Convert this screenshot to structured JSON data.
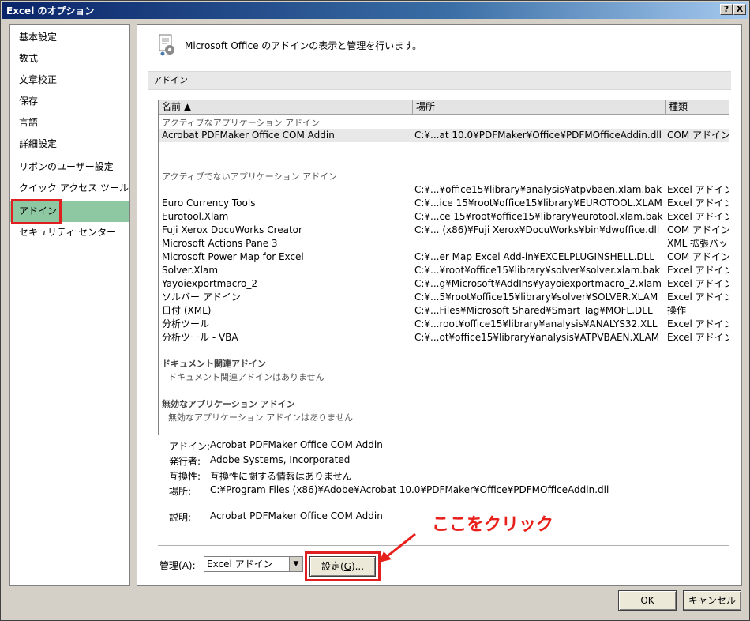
{
  "window": {
    "title": "Excel のオプション",
    "help_btn": "?",
    "close_btn": "X"
  },
  "nav": {
    "items": [
      {
        "label": "基本設定"
      },
      {
        "label": "数式"
      },
      {
        "label": "文章校正"
      },
      {
        "label": "保存"
      },
      {
        "label": "言語"
      },
      {
        "label": "詳細設定"
      },
      {
        "label": "リボンのユーザー設定"
      },
      {
        "label": "クイック アクセス ツール バー"
      },
      {
        "label": "アドイン",
        "active": true
      },
      {
        "label": "セキュリティ センター"
      }
    ]
  },
  "header": {
    "text": "Microsoft Office のアドインの表示と管理を行います。",
    "icon": "addin-gear-icon"
  },
  "section": {
    "title": "アドイン"
  },
  "table": {
    "columns": [
      "名前 ▲",
      "場所",
      "種類"
    ],
    "groups": {
      "active": "アクティブなアプリケーション アドイン",
      "inactive": "アクティブでないアプリケーション アドイン",
      "document": "ドキュメント関連アドイン",
      "document_empty": "ドキュメント関連アドインはありません",
      "disabled": "無効なアプリケーション アドイン",
      "disabled_empty": "無効なアプリケーション アドインはありません"
    },
    "active_rows": [
      {
        "name": "Acrobat PDFMaker Office COM Addin",
        "location": "C:¥...at 10.0¥PDFMaker¥Office¥PDFMOfficeAddin.dll",
        "type": "COM アドイン"
      }
    ],
    "inactive_rows": [
      {
        "name": "-",
        "location": "C:¥...¥office15¥library¥analysis¥atpvbaen.xlam.bak",
        "type": "Excel アドイン"
      },
      {
        "name": "Euro Currency Tools",
        "location": "C:¥...ice 15¥root¥office15¥library¥EUROTOOL.XLAM",
        "type": "Excel アドイン"
      },
      {
        "name": "Eurotool.Xlam",
        "location": "C:¥...ce 15¥root¥office15¥library¥eurotool.xlam.bak",
        "type": "Excel アドイン"
      },
      {
        "name": "Fuji Xerox DocuWorks Creator",
        "location": "C:¥... (x86)¥Fuji Xerox¥DocuWorks¥bin¥dwoffice.dll",
        "type": "COM アドイン"
      },
      {
        "name": "Microsoft Actions Pane 3",
        "location": "",
        "type": "XML 拡張パック"
      },
      {
        "name": "Microsoft Power Map for Excel",
        "location": "C:¥...er Map Excel Add-in¥EXCELPLUGINSHELL.DLL",
        "type": "COM アドイン"
      },
      {
        "name": "Solver.Xlam",
        "location": "C:¥...¥root¥office15¥library¥solver¥solver.xlam.bak",
        "type": "Excel アドイン"
      },
      {
        "name": "Yayoiexportmacro_2",
        "location": "C:¥...g¥Microsoft¥AddIns¥yayoiexportmacro_2.xlam",
        "type": "Excel アドイン"
      },
      {
        "name": "ソルバー アドイン",
        "location": "C:¥...5¥root¥office15¥library¥solver¥SOLVER.XLAM",
        "type": "Excel アドイン"
      },
      {
        "name": "日付 (XML)",
        "location": "C:¥...Files¥Microsoft Shared¥Smart Tag¥MOFL.DLL",
        "type": "操作"
      },
      {
        "name": "分析ツール",
        "location": "C:¥...root¥office15¥library¥analysis¥ANALYS32.XLL",
        "type": "Excel アドイン"
      },
      {
        "name": "分析ツール - VBA",
        "location": "C:¥...ot¥office15¥library¥analysis¥ATPVBAEN.XLAM",
        "type": "Excel アドイン"
      }
    ]
  },
  "details": {
    "addin_label": "アドイン:",
    "addin_value": "Acrobat PDFMaker Office COM Addin",
    "publisher_label": "発行者:",
    "publisher_value": "Adobe Systems, Incorporated",
    "compat_label": "互換性:",
    "compat_value": "互換性に関する情報はありません",
    "location_label": "場所:",
    "location_value": "C:¥Program Files (x86)¥Adobe¥Acrobat 10.0¥PDFMaker¥Office¥PDFMOfficeAddin.dll",
    "desc_label": "説明:",
    "desc_value": "Acrobat PDFMaker Office COM Addin"
  },
  "manage": {
    "label_pre": "管理(",
    "label_key": "A",
    "label_post": "):",
    "selected": "Excel アドイン",
    "go_pre": "設定(",
    "go_key": "G",
    "go_post": ")..."
  },
  "annotation": {
    "callout": "ここをクリック",
    "color": "#e8201c"
  },
  "footer": {
    "ok": "OK",
    "cancel": "キャンセル"
  }
}
